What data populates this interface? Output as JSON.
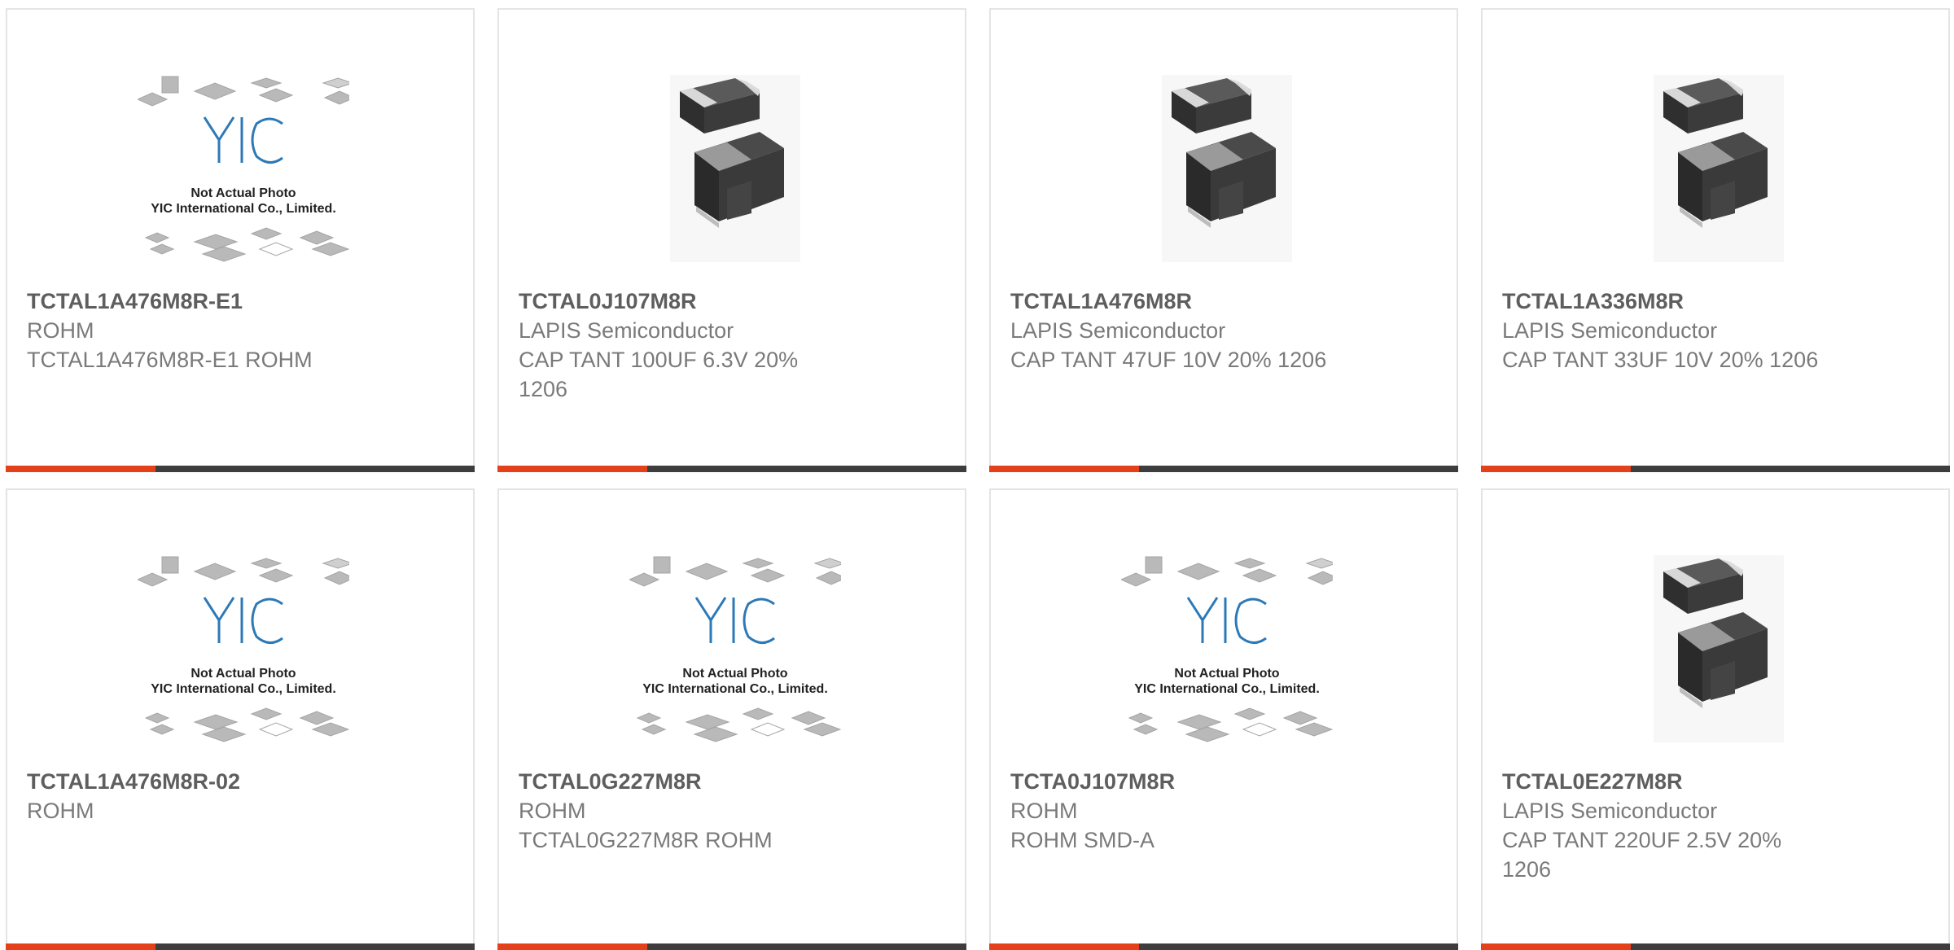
{
  "colors": {
    "accent": "#e4411b",
    "bar": "#3d3d3d"
  },
  "placeholder": {
    "line1": "Not Actual Photo",
    "line2": "YIC International Co., Limited.",
    "logo": "YIC"
  },
  "products": [
    {
      "part": "TCTAL1A476M8R-E1",
      "manufacturer": "ROHM",
      "description": "TCTAL1A476M8R-E1 ROHM",
      "image": "placeholder-photo"
    },
    {
      "part": "TCTAL0J107M8R",
      "manufacturer": "LAPIS Semiconductor",
      "description": "CAP TANT 100UF 6.3V 20% 1206",
      "image": "tantalum-chip-photo"
    },
    {
      "part": "TCTAL1A476M8R",
      "manufacturer": "LAPIS Semiconductor",
      "description": "CAP TANT 47UF 10V 20% 1206",
      "image": "tantalum-chip-photo"
    },
    {
      "part": "TCTAL1A336M8R",
      "manufacturer": "LAPIS Semiconductor",
      "description": "CAP TANT 33UF 10V 20% 1206",
      "image": "tantalum-chip-photo"
    },
    {
      "part": "TCTAL1A476M8R-02",
      "manufacturer": "ROHM",
      "description": "",
      "image": "placeholder-photo"
    },
    {
      "part": "TCTAL0G227M8R",
      "manufacturer": "ROHM",
      "description": "TCTAL0G227M8R ROHM",
      "image": "placeholder-photo"
    },
    {
      "part": "TCTA0J107M8R",
      "manufacturer": "ROHM",
      "description": "ROHM SMD-A",
      "image": "placeholder-photo"
    },
    {
      "part": "TCTAL0E227M8R",
      "manufacturer": "LAPIS Semiconductor",
      "description": "CAP TANT 220UF 2.5V 20% 1206",
      "image": "tantalum-chip-photo"
    }
  ]
}
